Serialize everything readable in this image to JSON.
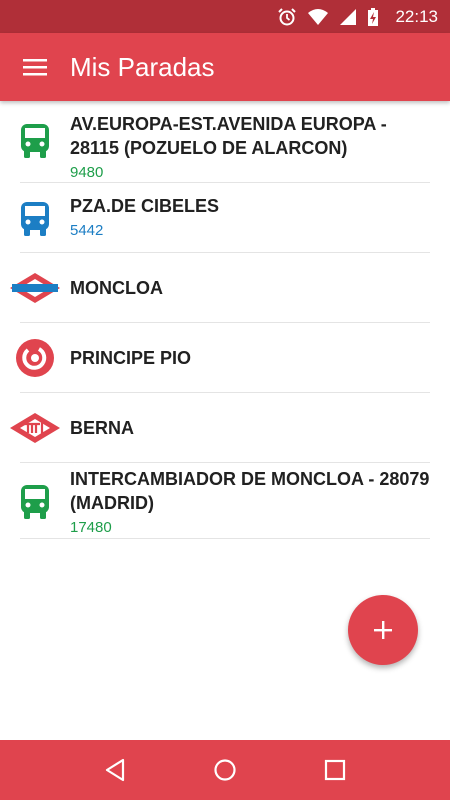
{
  "status_bar": {
    "time": "22:13",
    "icons": [
      "alarm-icon",
      "wifi-icon",
      "signal-icon",
      "battery-charging-icon"
    ]
  },
  "app_bar": {
    "title": "Mis Paradas",
    "menu_icon": "hamburger-menu-icon"
  },
  "stops": [
    {
      "name": "AV.EUROPA-EST.AVENIDA EUROPA - 28115 (POZUELO DE ALARCON)",
      "code": "9480",
      "icon": "bus-icon",
      "color": "#1e9e4a"
    },
    {
      "name": "PZA.DE CIBELES",
      "code": "5442",
      "icon": "bus-icon",
      "color": "#1c7ec4"
    },
    {
      "name": "MONCLOA",
      "code": "",
      "icon": "metro-icon",
      "color": "#e0444e"
    },
    {
      "name": "PRINCIPE PIO",
      "code": "",
      "icon": "cercanias-icon",
      "color": "#e0444e"
    },
    {
      "name": "BERNA",
      "code": "",
      "icon": "metro-ligero-icon",
      "color": "#e0444e"
    },
    {
      "name": "INTERCAMBIADOR DE MONCLOA - 28079 (MADRID)",
      "code": "17480",
      "icon": "bus-icon",
      "color": "#1e9e4a"
    }
  ],
  "fab": {
    "icon": "plus-icon"
  },
  "nav_bar": {
    "icons": [
      "back-icon",
      "home-icon",
      "recents-icon"
    ]
  },
  "colors": {
    "primary": "#e0444e",
    "status_bar": "#b02f38",
    "bus_green": "#1e9e4a",
    "bus_blue": "#1c7ec4"
  }
}
